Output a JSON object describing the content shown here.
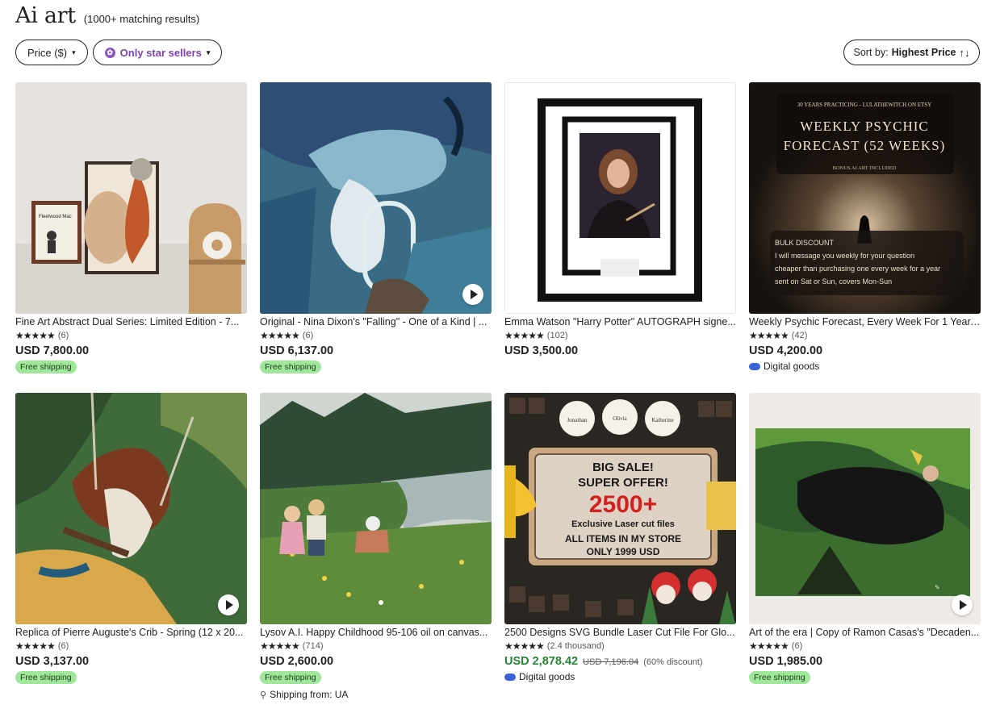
{
  "header": {
    "title": "Ai art",
    "count": "(1000+ matching results)"
  },
  "filters": {
    "price_label": "Price ($)",
    "star_label": "Only star sellers",
    "sort_prefix": "Sort by:",
    "sort_value": "Highest Price",
    "sort_icon": "up-down-arrows-icon",
    "caret": "▾"
  },
  "labels": {
    "free_shipping": "Free shipping",
    "digital_goods": "Digital goods",
    "shipping_from": "Shipping from: UA"
  },
  "colors": {
    "sale_price": "#258635",
    "free_shipping_bg": "#9ee79b",
    "star_seller": "#7f3fb5",
    "digital_icon": "#3a63d9"
  },
  "products": [
    {
      "title": "Fine Art Abstract Dual Series: Limited Edition - 7...",
      "stars": "★★★★★",
      "reviews": "(6)",
      "price": "USD 7,800.00",
      "badge": "Free shipping"
    },
    {
      "title": "Original - Nina Dixon's \"Falling\" - One of a Kind | ...",
      "stars": "★★★★★",
      "reviews": "(6)",
      "price": "USD 6,137.00",
      "badge": "Free shipping"
    },
    {
      "title": "Emma Watson \"Harry Potter\" AUTOGRAPH signe...",
      "stars": "★★★★★",
      "reviews": "(102)",
      "price": "USD 3,500.00"
    },
    {
      "title": "Weekly Psychic Forecast, Every Week For 1 Year, ...",
      "stars": "★★★★★",
      "reviews": "(42)",
      "price": "USD 4,200.00",
      "digital": "Digital goods"
    },
    {
      "title": "Replica of Pierre Auguste's Crib - Spring (12 x 20...",
      "stars": "★★★★★",
      "reviews": "(6)",
      "price": "USD 3,137.00",
      "badge": "Free shipping"
    },
    {
      "title": "Lysov A.I. Happy Childhood 95-106 oil on canvas...",
      "stars": "★★★★★",
      "reviews": "(714)",
      "price": "USD 2,600.00",
      "badge": "Free shipping",
      "location": "Shipping from: UA"
    },
    {
      "title": "2500 Designs SVG Bundle Laser Cut File For Glo...",
      "stars": "★★★★★",
      "reviews": "(2.4 thousand)",
      "price": "USD 2,878.42",
      "orig_price": "USD 7,196.04",
      "discount": "(60% discount)",
      "digital": "Digital goods"
    },
    {
      "title": "Art of the era | Copy of Ramon Casas's \"Decaden...",
      "stars": "★★★★★",
      "reviews": "(6)",
      "price": "USD 1,985.00",
      "badge": "Free shipping"
    }
  ],
  "images": {
    "fleetwood_text": "Fleetwood Mac",
    "psychic": {
      "top": "30 YEARS PRACTICING - LULATHEWITCH ON ETSY",
      "line1": "WEEKLY PSYCHIC",
      "line2": "FORECAST (52 WEEKS)",
      "sub": "BONUS AI ART INCLUDED",
      "bullets": [
        "BULK DISCOUNT",
        "I will message you weekly for your question",
        "cheaper than purchasing one every week for a year",
        "sent on Sat or Sun, covers Mon-Sun"
      ]
    },
    "laser": {
      "l1": "BIG SALE!",
      "l2": "SUPER OFFER!",
      "l3": "2500+",
      "l4": "Exclusive Laser cut files",
      "l5": "ALL ITEMS IN MY STORE",
      "l6": "ONLY 1999 USD",
      "ornaments": [
        "Jonathan",
        "Olivia",
        "Katherine"
      ]
    }
  }
}
